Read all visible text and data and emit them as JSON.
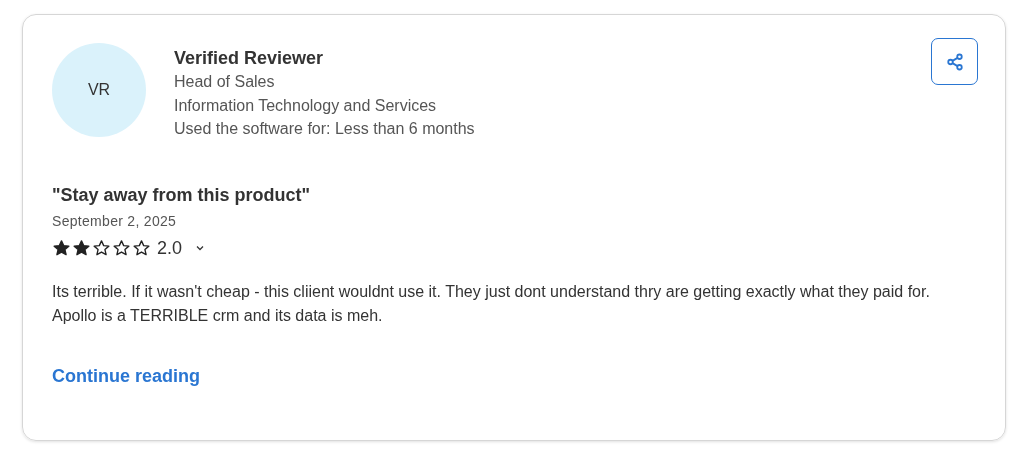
{
  "reviewer": {
    "initials": "VR",
    "name": "Verified Reviewer",
    "role": "Head of Sales",
    "industry": "Information Technology and Services",
    "usage": "Used the software for: Less than 6 months"
  },
  "review": {
    "title": "\"Stay away from this product\"",
    "date": "September 2, 2025",
    "stars": 2,
    "rating": "2.0",
    "body": "Its terrible. If it wasn't cheap - this cliient wouldnt use it. They just dont understand thry are getting exactly what they paid for. Apollo is a TERRIBLE crm and its data is meh.",
    "link": "Continue reading"
  }
}
